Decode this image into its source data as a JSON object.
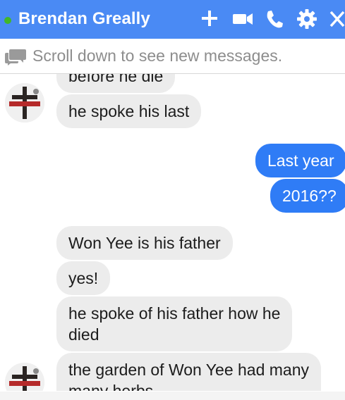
{
  "header": {
    "title": "Brendan Greally",
    "status": "online",
    "icons": [
      "add-icon",
      "video-call-icon",
      "phone-call-icon",
      "settings-icon",
      "close-icon"
    ],
    "background_color": "#4a8af4",
    "status_color": "#42b72a"
  },
  "notice": {
    "text": "Scroll down to see new messages.",
    "icon": "chat-bubbles-icon"
  },
  "messages": [
    {
      "sender": "them",
      "text": "before he die"
    },
    {
      "sender": "them",
      "text": "he spoke his last"
    },
    {
      "sender": "me",
      "text": "Last year"
    },
    {
      "sender": "me",
      "text": "2016??"
    },
    {
      "sender": "them",
      "text": "Won Yee is his father"
    },
    {
      "sender": "them",
      "text": "yes!"
    },
    {
      "sender": "them",
      "text": "he spoke of his father how he"
    },
    {
      "sender": "them",
      "text": "died"
    },
    {
      "sender": "them",
      "text": "the garden of Won Yee had many"
    },
    {
      "sender": "them",
      "text": "many herbs"
    }
  ],
  "colors": {
    "my_bubble": "#2f7cf6",
    "their_bubble": "#ececec"
  }
}
